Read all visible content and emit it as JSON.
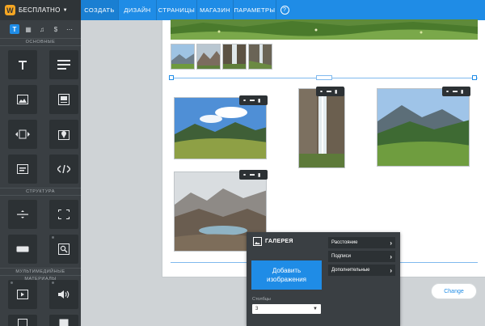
{
  "brand": {
    "label": "БЕСПЛАТНО",
    "logo_letter": "W",
    "accent": "#f5a623"
  },
  "nav": {
    "tabs": [
      {
        "label": "СОЗДАТЬ",
        "active": true
      },
      {
        "label": "ДИЗАЙН",
        "active": false
      },
      {
        "label": "СТРАНИЦЫ",
        "active": false
      },
      {
        "label": "МАГАЗИН",
        "active": false
      },
      {
        "label": "ПАРАМЕТРЫ",
        "active": false
      }
    ],
    "help_icon": "?",
    "accent": "#1f8ce6"
  },
  "sidebar": {
    "category_tabs": [
      {
        "glyph": "T",
        "icon": "text-icon",
        "active": true
      },
      {
        "glyph": "▦",
        "icon": "layout-icon",
        "active": false
      },
      {
        "glyph": "♫",
        "icon": "music-icon",
        "active": false
      },
      {
        "glyph": "$",
        "icon": "dollar-icon",
        "active": false
      },
      {
        "glyph": "⋯",
        "icon": "more-icon",
        "active": false
      }
    ],
    "sections": {
      "basic": "ОСНОВНЫЕ",
      "structure": "СТРУКТУРА",
      "multimedia": "МУЛЬТИМЕДИЙНЫЕ МАТЕРИАЛЫ"
    }
  },
  "gallery_panel": {
    "title": "ГАЛЕРЕЯ",
    "add_button": "Добавить изображения",
    "columns_label": "Столбцы",
    "columns_value": "3",
    "options": [
      "Расстояние",
      "Подписи",
      "Дополнительные"
    ]
  },
  "change_button": "Change"
}
